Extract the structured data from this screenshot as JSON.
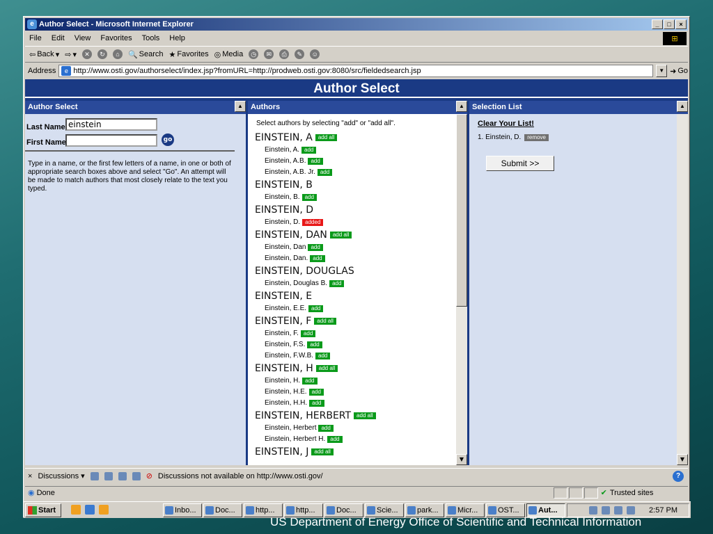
{
  "window": {
    "title": "Author Select - Microsoft Internet Explorer",
    "minimize": "_",
    "maximize": "□",
    "close": "×"
  },
  "menu": [
    "File",
    "Edit",
    "View",
    "Favorites",
    "Tools",
    "Help"
  ],
  "toolbar": {
    "back": "Back",
    "search": "Search",
    "favorites": "Favorites",
    "media": "Media"
  },
  "address": {
    "label": "Address",
    "url": "http://www.osti.gov/authorselect/index.jsp?fromURL=http://prodweb.osti.gov:8080/src/fieldedsearch.jsp",
    "go": "Go"
  },
  "banner": "Author Select",
  "left_pane": {
    "title": "Author Select",
    "last_name_label": "Last Name",
    "last_name_value": "einstein",
    "first_name_label": "First Name",
    "first_name_value": "",
    "go_label": "go",
    "help_text": "Type in a name, or the first few letters of a name, in one or both of appropriate search boxes above and select \"Go\". An attempt will be made to match authors that most closely relate to the text you typed."
  },
  "authors_pane": {
    "title": "Authors",
    "intro": "Select authors by selecting \"add\" or \"add all\".",
    "add_label": "add",
    "add_all_label": "add all",
    "added_label": "added",
    "groups": [
      {
        "name": "EINSTEIN, A",
        "add_all": true,
        "items": [
          {
            "name": "Einstein, A.",
            "status": "add"
          },
          {
            "name": "Einstein, A.B.",
            "status": "add"
          },
          {
            "name": "Einstein, A.B. Jr.",
            "status": "add"
          }
        ]
      },
      {
        "name": "EINSTEIN, B",
        "add_all": false,
        "items": [
          {
            "name": "Einstein, B.",
            "status": "add"
          }
        ]
      },
      {
        "name": "EINSTEIN, D",
        "add_all": false,
        "items": [
          {
            "name": "Einstein, D.",
            "status": "added"
          }
        ]
      },
      {
        "name": "EINSTEIN, DAN",
        "add_all": true,
        "items": [
          {
            "name": "Einstein, Dan",
            "status": "add"
          },
          {
            "name": "Einstein, Dan.",
            "status": "add"
          }
        ]
      },
      {
        "name": "EINSTEIN, DOUGLAS",
        "add_all": false,
        "items": [
          {
            "name": "Einstein, Douglas B.",
            "status": "add"
          }
        ]
      },
      {
        "name": "EINSTEIN, E",
        "add_all": false,
        "items": [
          {
            "name": "Einstein, E.E.",
            "status": "add"
          }
        ]
      },
      {
        "name": "EINSTEIN, F",
        "add_all": true,
        "items": [
          {
            "name": "Einstein, F.",
            "status": "add"
          },
          {
            "name": "Einstein, F.S.",
            "status": "add"
          },
          {
            "name": "Einstein, F.W.B.",
            "status": "add"
          }
        ]
      },
      {
        "name": "EINSTEIN, H",
        "add_all": true,
        "items": [
          {
            "name": "Einstein, H.",
            "status": "add"
          },
          {
            "name": "Einstein, H.E.",
            "status": "add"
          },
          {
            "name": "Einstein, H.H.",
            "status": "add"
          }
        ]
      },
      {
        "name": "EINSTEIN, HERBERT",
        "add_all": true,
        "items": [
          {
            "name": "Einstein, Herbert",
            "status": "add"
          },
          {
            "name": "Einstein, Herbert H.",
            "status": "add"
          }
        ]
      },
      {
        "name": "EINSTEIN, J",
        "add_all": true,
        "items": []
      }
    ]
  },
  "selection_pane": {
    "title": "Selection List",
    "clear_label": "Clear Your List!",
    "items": [
      {
        "label": "1. Einstein, D.",
        "remove_label": "remove"
      }
    ],
    "submit_label": "Submit >>"
  },
  "discussions": {
    "close": "×",
    "label": "Discussions ▾",
    "message": "Discussions not available on http://www.osti.gov/"
  },
  "status": {
    "text": "Done",
    "zone": "Trusted sites"
  },
  "taskbar": {
    "start": "Start",
    "buttons": [
      "Inbo...",
      "Doc...",
      "http...",
      "http...",
      "Doc...",
      "Scie...",
      "park...",
      "Micr...",
      "OST...",
      "Aut..."
    ],
    "active_index": 9,
    "clock": "2:57 PM"
  },
  "slide_caption": "US Department of Energy Office of Scientific and Technical Information"
}
